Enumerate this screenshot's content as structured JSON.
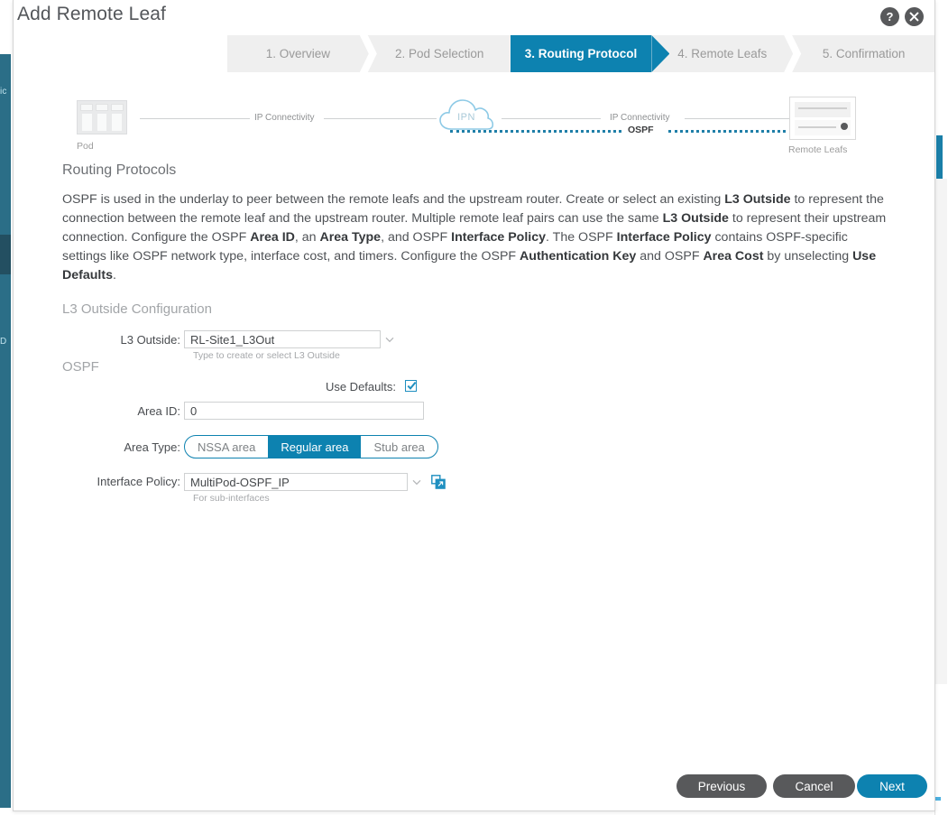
{
  "background": {
    "rail_labels": [
      "ic",
      "D"
    ]
  },
  "modal": {
    "title": "Add Remote Leaf",
    "help_icon": "help-circle-icon",
    "close_icon": "close-circle-icon"
  },
  "wizard": {
    "steps": [
      {
        "label": "1. Overview",
        "active": false
      },
      {
        "label": "2. Pod Selection",
        "active": false
      },
      {
        "label": "3. Routing Protocol",
        "active": true
      },
      {
        "label": "4. Remote Leafs",
        "active": false
      },
      {
        "label": "5. Confirmation",
        "active": false
      }
    ]
  },
  "diagram": {
    "pod_label": "Pod",
    "ipn_label": "IPN",
    "remote_leafs_label": "Remote Leafs",
    "link_left_label": "IP Connectivity",
    "link_right_label": "IP Connectivity",
    "protocol_label": "OSPF"
  },
  "content": {
    "heading": "Routing Protocols",
    "paragraph_parts": [
      {
        "t": "OSPF is used in the underlay to peer between the remote leafs and the upstream router. Create or select an existing ",
        "b": false
      },
      {
        "t": "L3 Outside",
        "b": true
      },
      {
        "t": " to represent the connection between the remote leaf and the upstream router. Multiple remote leaf pairs can use the same ",
        "b": false
      },
      {
        "t": "L3 Outside",
        "b": true
      },
      {
        "t": " to represent their upstream connection. Configure the OSPF ",
        "b": false
      },
      {
        "t": "Area ID",
        "b": true
      },
      {
        "t": ", an ",
        "b": false
      },
      {
        "t": "Area Type",
        "b": true
      },
      {
        "t": ", and OSPF ",
        "b": false
      },
      {
        "t": "Interface Policy",
        "b": true
      },
      {
        "t": ". The OSPF ",
        "b": false
      },
      {
        "t": "Interface Policy",
        "b": true
      },
      {
        "t": " contains OSPF-specific settings like OSPF network type, interface cost, and timers. Configure the OSPF ",
        "b": false
      },
      {
        "t": "Authentication Key",
        "b": true
      },
      {
        "t": " and OSPF ",
        "b": false
      },
      {
        "t": "Area Cost",
        "b": true
      },
      {
        "t": " by unselecting ",
        "b": false
      },
      {
        "t": "Use Defaults",
        "b": true
      },
      {
        "t": ".",
        "b": false
      }
    ]
  },
  "form": {
    "l3out_group_title": "L3 Outside Configuration",
    "l3out_label": "L3 Outside:",
    "l3out_value": "RL-Site1_L3Out",
    "l3out_helper": "Type to create or select L3 Outside",
    "ospf_group_title": "OSPF",
    "use_defaults_label": "Use Defaults:",
    "use_defaults_checked": true,
    "area_id_label": "Area ID:",
    "area_id_value": "0",
    "area_type_label": "Area Type:",
    "area_type_options": [
      "NSSA area",
      "Regular area",
      "Stub area"
    ],
    "area_type_selected": "Regular area",
    "interface_policy_label": "Interface Policy:",
    "interface_policy_value": "MultiPod-OSPF_IP",
    "interface_policy_helper": "For sub-interfaces",
    "interface_policy_launch_icon": "launch-external-icon"
  },
  "footer": {
    "previous_label": "Previous",
    "cancel_label": "Cancel",
    "next_label": "Next"
  },
  "colors": {
    "accent_blue": "#0d82b0",
    "step_inactive_bg": "#efefef",
    "button_grey": "#58595b",
    "nav_rail": "#2b6e87"
  }
}
